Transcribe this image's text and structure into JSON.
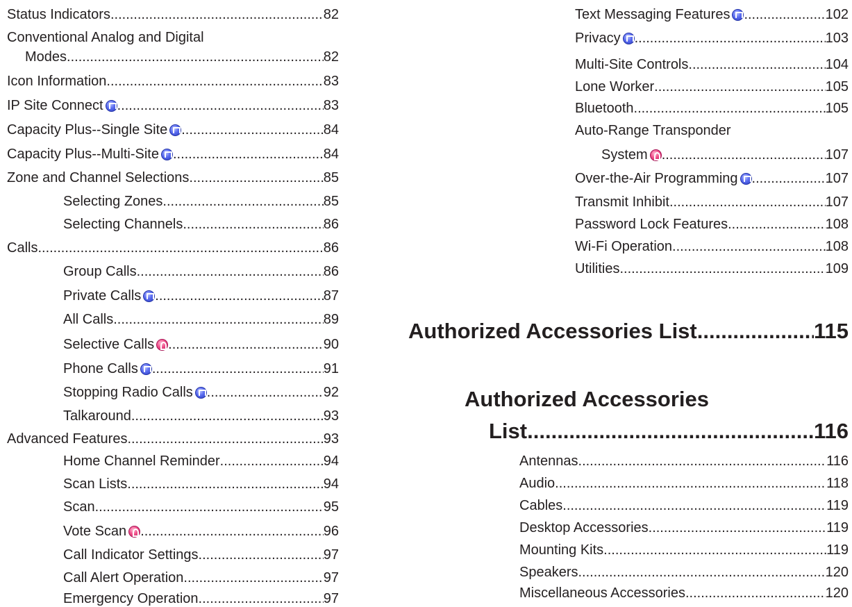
{
  "left_column": [
    {
      "text": "Status Indicators",
      "page": "82"
    },
    {
      "text": "Conventional Analog and Digital",
      "page": ""
    },
    {
      "text": "Modes",
      "page": "82"
    },
    {
      "text": "Icon Information",
      "page": "83"
    },
    {
      "text": "IP Site Connect",
      "page": "83",
      "icon": "digital-mode-icon"
    },
    {
      "text": "Capacity Plus--Single Site",
      "page": "84",
      "icon": "digital-mode-icon"
    },
    {
      "text": "Capacity Plus--Multi-Site",
      "page": "84",
      "icon": "digital-mode-icon"
    },
    {
      "text": "Zone and Channel Selections",
      "page": "85"
    },
    {
      "text": "Selecting Zones",
      "page": "85"
    },
    {
      "text": "Selecting Channels",
      "page": "86"
    },
    {
      "text": "Calls",
      "page": "86"
    },
    {
      "text": "Group Calls",
      "page": "86"
    },
    {
      "text": "Private Calls ",
      "page": "87",
      "icon": "digital-mode-icon"
    },
    {
      "text": "All Calls",
      "page": "89"
    },
    {
      "text": "Selective Calls ",
      "page": "90",
      "icon": "analog-mode-icon"
    },
    {
      "text": "Phone Calls ",
      "page": "91",
      "icon": "digital-mode-icon"
    },
    {
      "text": "Stopping Radio Calls ",
      "page": "92",
      "icon": "digital-mode-icon"
    },
    {
      "text": "Talkaround",
      "page": "93"
    },
    {
      "text": "Advanced Features",
      "page": "93"
    },
    {
      "text": "Home Channel Reminder",
      "page": "94"
    },
    {
      "text": "Scan Lists",
      "page": "94"
    },
    {
      "text": "Scan",
      "page": "95"
    },
    {
      "text": "Vote Scan ",
      "page": "96",
      "icon": "analog-mode-icon"
    },
    {
      "text": "Call Indicator Settings",
      "page": "97"
    },
    {
      "text": "Call Alert Operation",
      "page": "97"
    },
    {
      "text": "Emergency Operation",
      "page": "97"
    }
  ],
  "right_column_top": [
    {
      "text": "Text Messaging Features ",
      "page": "102",
      "icon": "digital-mode-icon"
    },
    {
      "text": "Privacy ",
      "page": "103",
      "icon": "digital-mode-icon"
    },
    {
      "text": "Multi-Site Controls",
      "page": "104"
    },
    {
      "text": "Lone Worker",
      "page": "105"
    },
    {
      "text": "Bluetooth",
      "page": "105"
    },
    {
      "text": "Auto-Range Transponder",
      "page": ""
    },
    {
      "text": "System",
      "page": "107",
      "icon": "analog-mode-icon"
    },
    {
      "text": "Over-the-Air Programming ",
      "page": "107",
      "icon": "digital-mode-icon"
    },
    {
      "text": "Transmit Inhibit",
      "page": "107"
    },
    {
      "text": "Password Lock Features",
      "page": "108"
    },
    {
      "text": "Wi-Fi Operation",
      "page": "108"
    },
    {
      "text": "Utilities",
      "page": "109"
    }
  ],
  "chapter_1": {
    "text": "Authorized Accessories List",
    "page": "115"
  },
  "chapter_2": {
    "line1": "Authorized Accessories",
    "line2": "List",
    "page": "116"
  },
  "right_column_bottom": [
    {
      "text": "Antennas",
      "page": "116"
    },
    {
      "text": "Audio",
      "page": "118"
    },
    {
      "text": "Cables",
      "page": "119"
    },
    {
      "text": "Desktop Accessories",
      "page": "119"
    },
    {
      "text": "Mounting Kits",
      "page": "119"
    },
    {
      "text": "Speakers",
      "page": "120"
    },
    {
      "text": "Miscellaneous Accessories",
      "page": "120"
    }
  ]
}
